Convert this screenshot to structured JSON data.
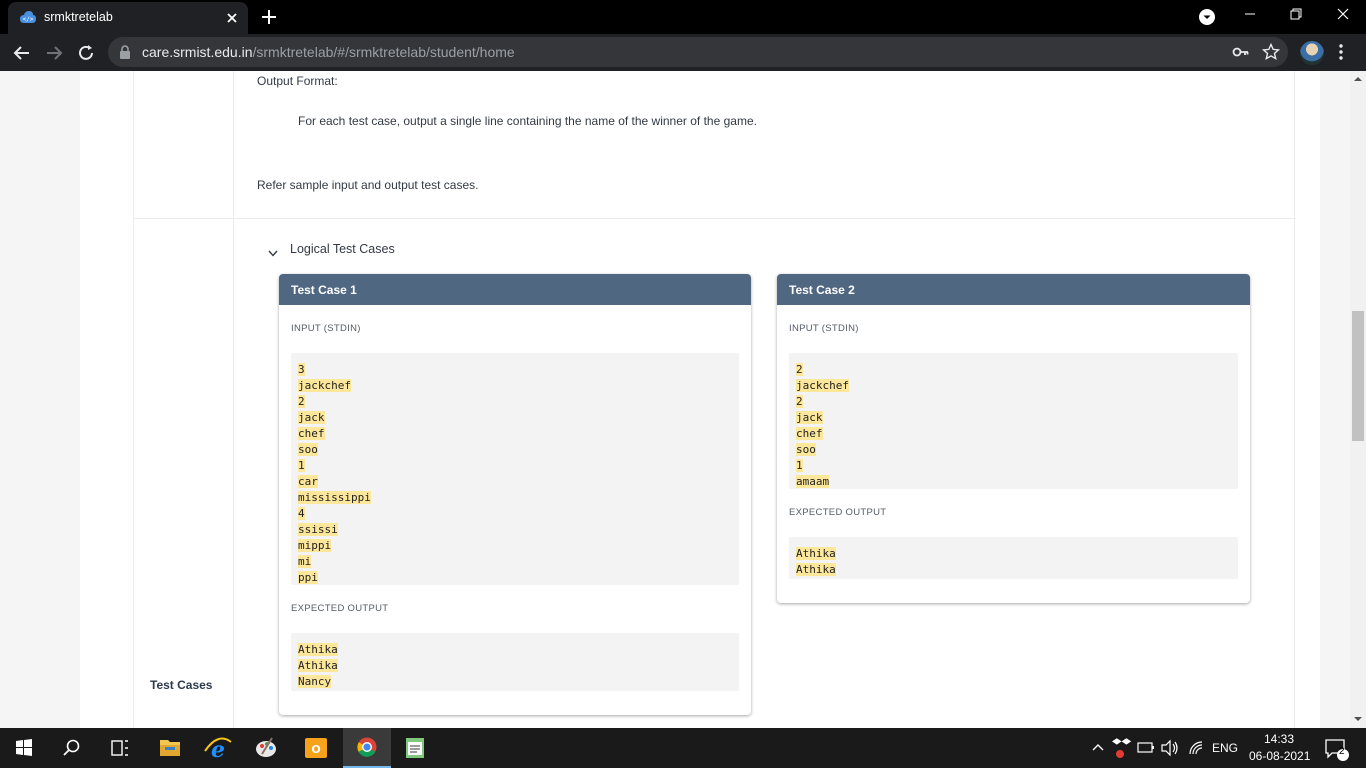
{
  "browser": {
    "tab_title": "srmktretelab",
    "url_host": "care.srmist.edu.in",
    "url_path": "/srmktretelab/#/srmktretelab/student/home"
  },
  "content": {
    "output_format_label": "Output Format:",
    "output_format_text": "For each test case, output a single line containing the name of the winner of the game.",
    "refer_text": "Refer sample input and output test cases.",
    "logical_test_cases_label": "Logical Test Cases",
    "test_cases_label": "Test Cases",
    "test_cases": [
      {
        "title": "Test Case 1",
        "input_label": "INPUT (STDIN)",
        "input_lines": [
          "3",
          "jackchef",
          "2",
          "jack",
          "chef",
          "soo",
          "1",
          "car",
          "mississippi",
          "4",
          "ssissi",
          "mippi",
          "mi",
          "ppi"
        ],
        "output_label": "EXPECTED OUTPUT",
        "output_lines": [
          "Athika",
          "Athika",
          "Nancy"
        ]
      },
      {
        "title": "Test Case 2",
        "input_label": "INPUT (STDIN)",
        "input_lines": [
          "2",
          "jackchef",
          "2",
          "jack",
          "chef",
          "soo",
          "1",
          "amaam"
        ],
        "output_label": "EXPECTED OUTPUT",
        "output_lines": [
          "Athika",
          "Athika"
        ]
      }
    ]
  },
  "taskbar": {
    "language": "ENG",
    "time": "14:33",
    "date": "06-08-2021",
    "notification_count": "2"
  },
  "colors": {
    "card_header": "#4f6781",
    "code_highlight": "#fce79b",
    "browser_chrome": "#202124"
  }
}
